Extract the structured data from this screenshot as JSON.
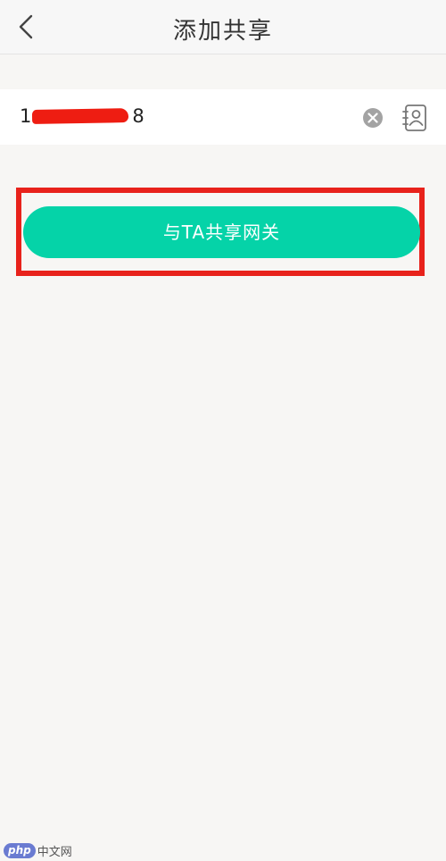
{
  "header": {
    "title": "添加共享"
  },
  "input": {
    "value_visible_start": "1",
    "value_visible_end": "8"
  },
  "actions": {
    "share_button_label": "与TA共享网关"
  },
  "watermark": {
    "logo": "php",
    "text": "中文网"
  },
  "colors": {
    "accent": "#05d3a8",
    "highlight": "#e8221b",
    "redaction": "#ee1d12"
  },
  "icons": {
    "back": "chevron-left-icon",
    "clear": "clear-icon",
    "contact": "contact-book-icon"
  }
}
